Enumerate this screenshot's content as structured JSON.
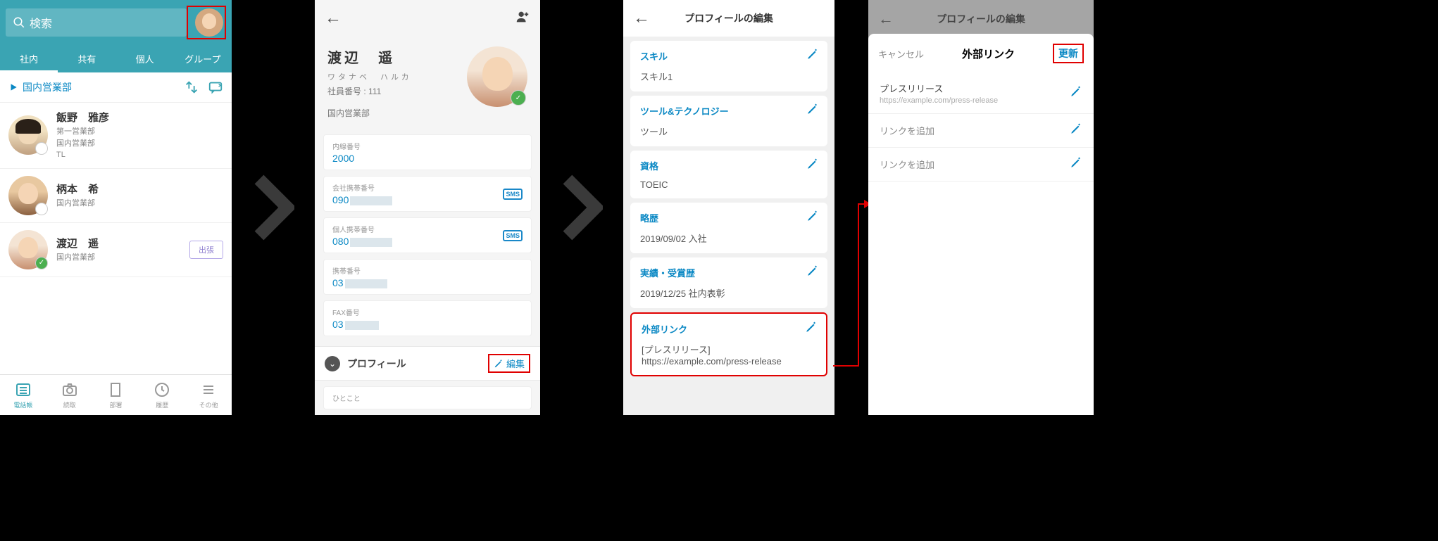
{
  "screen1": {
    "search_placeholder": "検索",
    "tabs": [
      "社内",
      "共有",
      "個人",
      "グループ"
    ],
    "department": "国内営業部",
    "contacts": [
      {
        "name": "飯野　雅彦",
        "lines": [
          "第一営業部",
          "国内営業部",
          "TL"
        ]
      },
      {
        "name": "柄本　希",
        "lines": [
          "国内営業部"
        ]
      },
      {
        "name": "渡辺　遥",
        "lines": [
          "国内営業部"
        ],
        "away": "出張"
      }
    ],
    "nav": [
      "電話帳",
      "読取",
      "部署",
      "履歴",
      "その他"
    ]
  },
  "screen2": {
    "name": "渡辺　遥",
    "kana": "ワタナベ　ハルカ",
    "emp_no_label": "社員番号",
    "emp_no": "111",
    "dept": "国内営業部",
    "fields": [
      {
        "label": "内線番号",
        "value": "2000",
        "sms": false
      },
      {
        "label": "会社携帯番号",
        "value": "090",
        "sms": true,
        "masked": true
      },
      {
        "label": "個人携帯番号",
        "value": "080",
        "sms": true,
        "masked": true
      },
      {
        "label": "携帯番号",
        "value": "03",
        "sms": false,
        "masked": true
      },
      {
        "label": "FAX番号",
        "value": "03",
        "sms": false,
        "masked": true
      }
    ],
    "section_label": "プロフィール",
    "edit_label": "編集",
    "hitokoto_label": "ひとこと",
    "sms_label": "SMS"
  },
  "screen3": {
    "title": "プロフィールの編集",
    "cards": [
      {
        "label": "スキル",
        "value": "スキル1"
      },
      {
        "label": "ツール&テクノロジー",
        "value": "ツール"
      },
      {
        "label": "資格",
        "value": "TOEIC"
      },
      {
        "label": "略歴",
        "value": "2019/09/02 入社"
      },
      {
        "label": "実績・受賞歴",
        "value": "2019/12/25 社内表彰"
      },
      {
        "label": "外部リンク",
        "value": "[プレスリリース] https://example.com/press-release"
      }
    ]
  },
  "screen4": {
    "dim_title": "プロフィールの編集",
    "cancel": "キャンセル",
    "title": "外部リンク",
    "update": "更新",
    "link1_title": "プレスリリース",
    "link1_url": "https://example.com/press-release",
    "add_link": "リンクを追加"
  }
}
